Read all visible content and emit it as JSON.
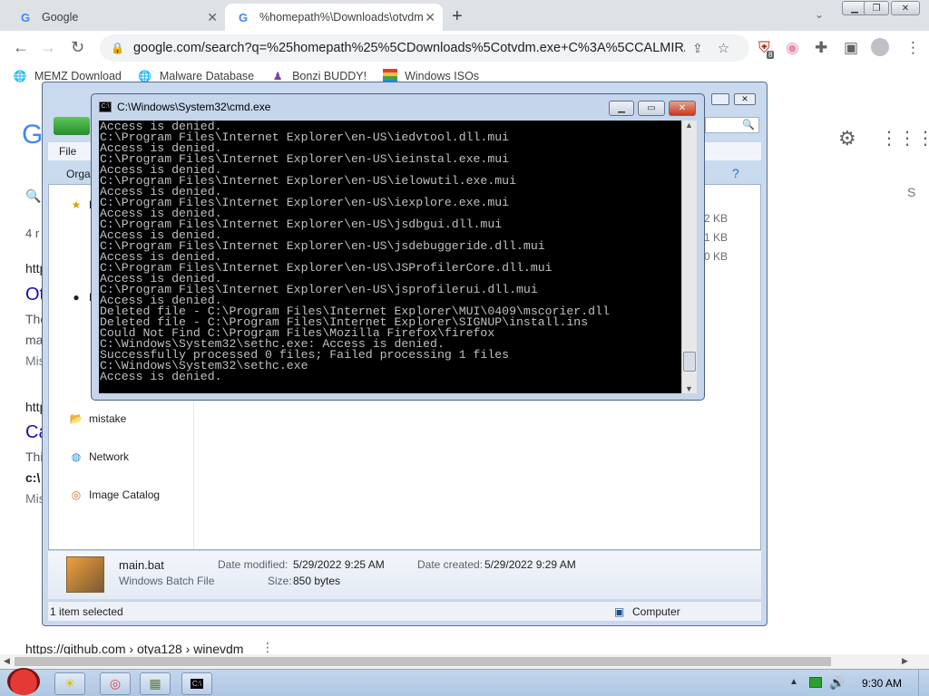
{
  "browser": {
    "tabs": [
      {
        "title": "Google",
        "icon": "google-icon"
      },
      {
        "title": "%homepath%\\Downloads\\otvdm",
        "icon": "google-icon"
      }
    ],
    "url": "google.com/search?q=%25homepath%25%5CDownloads%5Cotvdm.exe+C%3A%5CCALMIRA%5...",
    "extension_badge": "8",
    "bookmarks": [
      {
        "label": "MEMZ Download",
        "icon": "globe-icon"
      },
      {
        "label": "Malware Database",
        "icon": "globe-icon"
      },
      {
        "label": "Bonzi BUDDY!",
        "icon": "bonzi-icon"
      },
      {
        "label": "Windows ISOs",
        "icon": "windows-flag-icon"
      }
    ]
  },
  "google_page": {
    "logo_letter": "G",
    "results_count_partial": "4 r",
    "snippets": [
      "http",
      "Ot",
      "The",
      "ma",
      "Mis",
      "http",
      "Ca",
      "Thi",
      "c:\\",
      "Mis"
    ],
    "bottom_breadcrumb": "https://github.com › otya128 › winevdm",
    "right_fragment": "S"
  },
  "explorer": {
    "menu_file": "File",
    "toolbar_organize": "Orga",
    "nav_items": [
      {
        "label": "mistake",
        "icon": "folder-icon"
      },
      {
        "label": "Network",
        "icon": "network-icon"
      },
      {
        "label": "Image Catalog",
        "icon": "catalog-icon"
      }
    ],
    "nav_partial_labels": [
      "F",
      "L"
    ],
    "size_fragments": [
      "2 KB",
      "1 KB",
      "0 KB"
    ],
    "details": {
      "file_name": "main.bat",
      "file_type": "Windows Batch File",
      "date_modified_label": "Date modified:",
      "date_modified": "5/29/2022 9:25 AM",
      "date_created_label": "Date created:",
      "date_created": "5/29/2022 9:29 AM",
      "size_label": "Size:",
      "size": "850 bytes"
    },
    "status_selected": "1 item selected",
    "status_location": "Computer"
  },
  "cmd": {
    "title": "C:\\Windows\\System32\\cmd.exe",
    "lines": [
      "Access is denied.",
      "C:\\Program Files\\Internet Explorer\\en-US\\iedvtool.dll.mui",
      "Access is denied.",
      "C:\\Program Files\\Internet Explorer\\en-US\\ieinstal.exe.mui",
      "Access is denied.",
      "C:\\Program Files\\Internet Explorer\\en-US\\ielowutil.exe.mui",
      "Access is denied.",
      "C:\\Program Files\\Internet Explorer\\en-US\\iexplore.exe.mui",
      "Access is denied.",
      "C:\\Program Files\\Internet Explorer\\en-US\\jsdbgui.dll.mui",
      "Access is denied.",
      "C:\\Program Files\\Internet Explorer\\en-US\\jsdebuggeride.dll.mui",
      "Access is denied.",
      "C:\\Program Files\\Internet Explorer\\en-US\\JSProfilerCore.dll.mui",
      "Access is denied.",
      "C:\\Program Files\\Internet Explorer\\en-US\\jsprofilerui.dll.mui",
      "Access is denied.",
      "Deleted file - C:\\Program Files\\Internet Explorer\\MUI\\0409\\mscorier.dll",
      "Deleted file - C:\\Program Files\\Internet Explorer\\SIGNUP\\install.ins",
      "Could Not Find C:\\Program Files\\Mozilla Firefox\\firefox",
      "C:\\Windows\\System32\\sethc.exe: Access is denied.",
      "Successfully processed 0 files; Failed processing 1 files",
      "C:\\Windows\\System32\\sethc.exe",
      "Access is denied."
    ]
  },
  "taskbar": {
    "clock": "9:30 AM",
    "apps": [
      "sun-icon",
      "chrome-icon",
      "explorer-icon",
      "cmd-icon"
    ]
  }
}
